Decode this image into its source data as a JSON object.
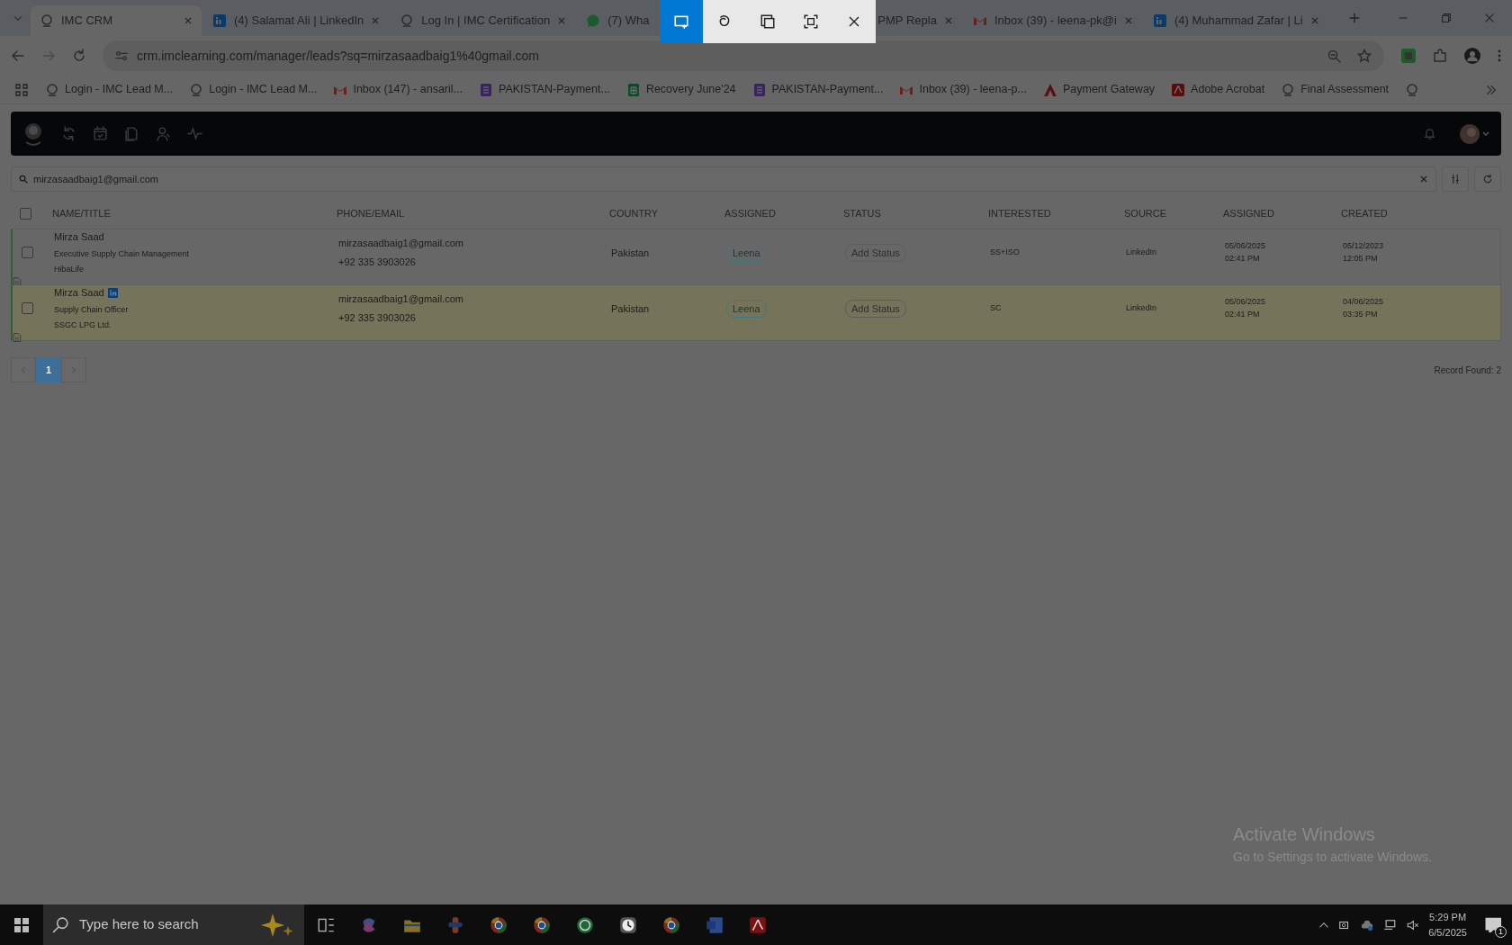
{
  "browser": {
    "tabs": [
      {
        "title": "IMC CRM",
        "selected": true
      },
      {
        "title": "(4) Salamat Ali | LinkedIn",
        "selected": false
      },
      {
        "title": "Log In | IMC Certification",
        "selected": false
      },
      {
        "title": "(7) Wha",
        "selected": false
      },
      {
        "title": "PMP Repla",
        "selected": false
      },
      {
        "title": "Inbox (39) - leena-pk@i",
        "selected": false
      },
      {
        "title": "(4) Muhammad Zafar | Li",
        "selected": false
      }
    ],
    "address": "crm.imclearning.com/manager/leads?sq=mirzasaadbaig1%40gmail.com",
    "bookmarks": [
      {
        "label": "Login - IMC Lead M..."
      },
      {
        "label": "Login - IMC Lead M..."
      },
      {
        "label": "Inbox (147) - ansaril..."
      },
      {
        "label": "PAKISTAN-Payment..."
      },
      {
        "label": "Recovery June'24"
      },
      {
        "label": "PAKISTAN-Payment..."
      },
      {
        "label": "Inbox (39) - leena-p..."
      },
      {
        "label": "Payment Gateway"
      },
      {
        "label": "Adobe Acrobat"
      },
      {
        "label": "Final Assessment"
      }
    ]
  },
  "snip_toolbar": {
    "modes": [
      {
        "kind": "rectangle",
        "selected": true
      },
      {
        "kind": "freeform",
        "selected": false
      },
      {
        "kind": "window",
        "selected": false
      },
      {
        "kind": "fullscreen",
        "selected": false
      }
    ]
  },
  "search": {
    "value": "mirzasaadbaig1@gmail.com"
  },
  "table": {
    "select_all": {
      "checked": false
    },
    "columns": [
      "NAME/TITLE",
      "PHONE/EMAIL",
      "COUNTRY",
      "ASSIGNED",
      "STATUS",
      "INTERESTED",
      "SOURCE",
      "ASSIGNED",
      "CREATED"
    ],
    "rows": [
      {
        "checked": false,
        "name": "Mirza Saad",
        "linkedin": false,
        "title": "Executive Supply Chain Management",
        "company": "HibaLife",
        "email": "mirzasaadbaig1@gmail.com",
        "phone": "+92 335 3903026",
        "country": "Pakistan",
        "assigned_to": "Leena",
        "status": "Add Status",
        "interested": "SS+ISO",
        "source": "LinkedIn",
        "assigned_date": "05/06/2025",
        "assigned_time": "02:41 PM",
        "created_date": "05/12/2023",
        "created_time": "12:05 PM",
        "highlighted": false
      },
      {
        "checked": false,
        "name": "Mirza Saad",
        "linkedin": true,
        "title": "Supply Chain Officer",
        "company": "SSGC LPG Ltd.",
        "email": "mirzasaadbaig1@gmail.com",
        "phone": "+92 335 3903026",
        "country": "Pakistan",
        "assigned_to": "Leena",
        "status": "Add Status",
        "interested": "SC",
        "source": "LinkedIn",
        "assigned_date": "05/06/2025",
        "assigned_time": "02:41 PM",
        "created_date": "04/06/2025",
        "created_time": "03:35 PM",
        "highlighted": true
      }
    ]
  },
  "pagination": {
    "pages": [
      {
        "label": "1",
        "selected": true
      }
    ],
    "record_count": "Record Found: 2"
  },
  "watermark": {
    "title": "Activate Windows",
    "subtitle": "Go to Settings to activate Windows."
  },
  "taskbar": {
    "search_placeholder": "Type here to search",
    "time": "5:29 PM",
    "date": "6/5/2025",
    "notifications": "1"
  }
}
